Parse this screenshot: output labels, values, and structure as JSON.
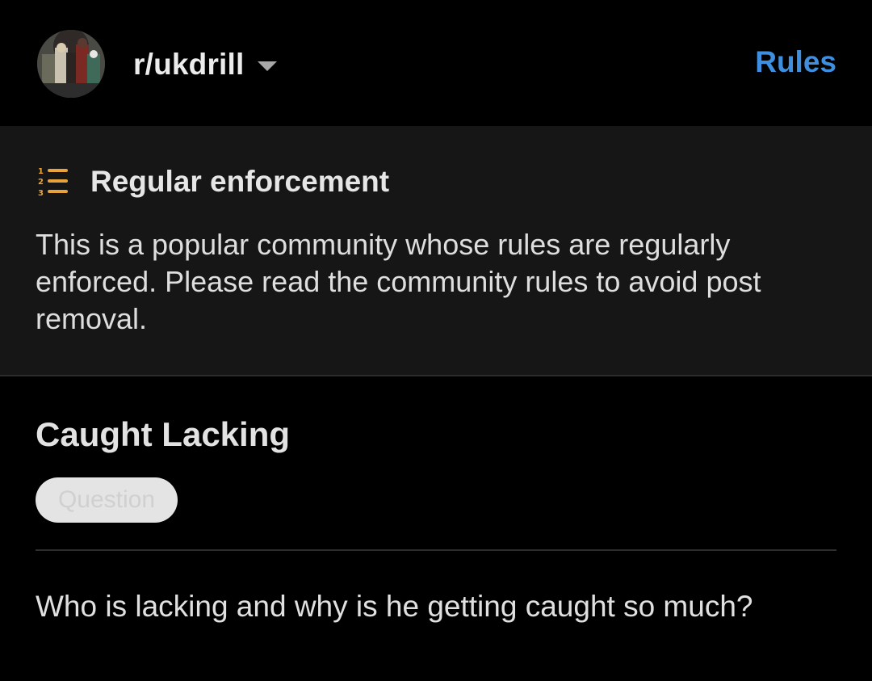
{
  "header": {
    "community_name": "r/ukdrill",
    "rules_label": "Rules",
    "avatar_icon": "community-avatar",
    "dropdown_icon": "caret-down-icon"
  },
  "banner": {
    "icon": "numbered-list-icon",
    "title": "Regular enforcement",
    "text": "This is a popular community whose rules are regularly enforced. Please read the community rules to avoid post removal."
  },
  "post": {
    "title": "Caught Lacking",
    "flair": "Question",
    "body": "Who is lacking and why is he getting caught so much?"
  },
  "colors": {
    "accent": "#3e8fe0",
    "list_icon": "#e8a33c",
    "background": "#000000",
    "banner_background": "#161616"
  }
}
